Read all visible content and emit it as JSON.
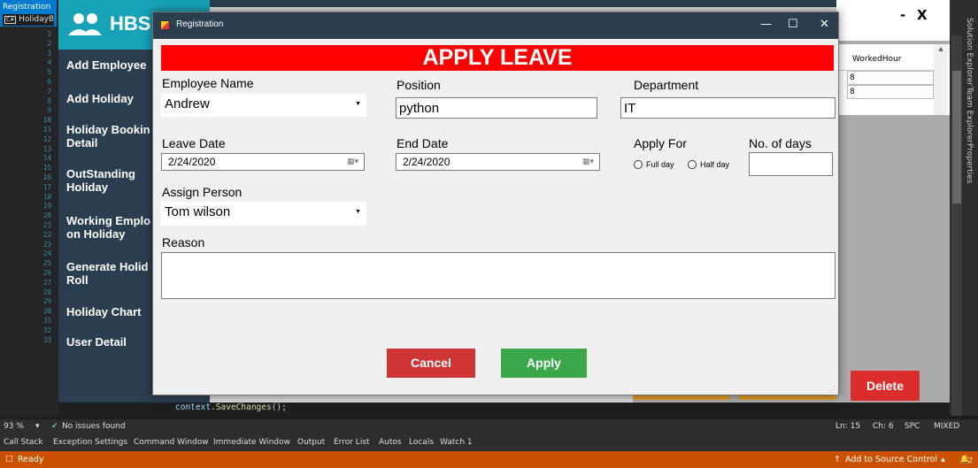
{
  "vs": {
    "doc_tab": "Registration",
    "doc_tab_sub": "HolidayB",
    "line_numbers": [
      "1",
      "2",
      "3",
      "4",
      "5",
      "6",
      "7",
      "8",
      "9",
      "10",
      "11",
      "12",
      "13",
      "14",
      "15",
      "16",
      "17",
      "18",
      "19",
      "20",
      "21",
      "22",
      "23",
      "24",
      "25",
      "26",
      "27",
      "28",
      "29",
      "30",
      "31",
      "32",
      "33"
    ],
    "code_line": "context.SaveChanges();",
    "code_obj": "context",
    "code_method": "SaveChanges",
    "side_tabs": [
      "Solution Explorer",
      "Team Explorer",
      "Properties"
    ],
    "editor_status": {
      "zoom": "93 %",
      "issues": "No issues found",
      "ln": "Ln: 15",
      "ch": "Ch: 6",
      "spc": "SPC",
      "mixed": "MIXED"
    },
    "tool_tabs": [
      "Call Stack",
      "Exception Settings",
      "Command Window",
      "Immediate Window",
      "Output",
      "Error List",
      "Autos",
      "Locals",
      "Watch 1"
    ],
    "status_bar": {
      "ready": "Ready",
      "source_control": "Add to Source Control",
      "badge": "2"
    }
  },
  "hbs": {
    "title": "HBS",
    "nav": [
      "Add Employee",
      "Add Holiday",
      "Holiday Bookin\nDetail",
      "OutStanding\nHoliday",
      "Working Emplo\non Holiday",
      "Generate Holid\nRoll",
      "Holiday Chart",
      "User Detail"
    ],
    "right_window": {
      "min": "-",
      "close": "X",
      "grid_header": "WorkedHour",
      "grid_cells": [
        "8",
        "8"
      ]
    },
    "delete_label": "Delete"
  },
  "dialog": {
    "title": "Registration",
    "controls": {
      "min": "—",
      "max": "☐",
      "close": "✕"
    },
    "banner": "APPLY LEAVE",
    "employee_name": {
      "label": "Employee Name",
      "value": "Andrew"
    },
    "position": {
      "label": "Position",
      "value": "python"
    },
    "department": {
      "label": "Department",
      "value": "IT"
    },
    "leave_date": {
      "label": "Leave Date",
      "value": "2/24/2020"
    },
    "end_date": {
      "label": "End Date",
      "value": "2/24/2020"
    },
    "apply_for": {
      "label": "Apply For",
      "options": [
        "Full day",
        "Half day"
      ]
    },
    "no_of_days": {
      "label": "No. of days",
      "value": ""
    },
    "assign_person": {
      "label": "Assign Person",
      "value": "Tom wilson"
    },
    "reason": {
      "label": "Reason",
      "value": ""
    },
    "cancel_label": "Cancel",
    "apply_label": "Apply"
  }
}
